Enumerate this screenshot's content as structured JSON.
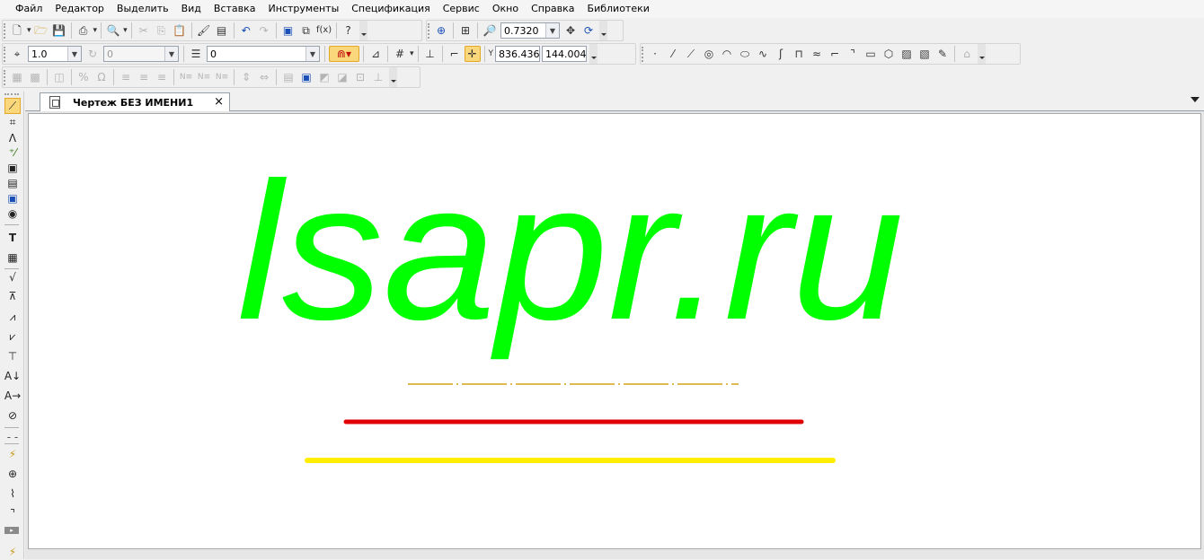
{
  "menu": [
    "Файл",
    "Редактор",
    "Выделить",
    "Вид",
    "Вставка",
    "Инструменты",
    "Спецификация",
    "Сервис",
    "Окно",
    "Справка",
    "Библиотеки"
  ],
  "toolbar": {
    "zoom_value": "0.7320",
    "step_value": "1.0",
    "angle_value": "0",
    "layer_value": "0",
    "coord_x": "836.436",
    "coord_y": "144.004",
    "fx_label": "f(x)"
  },
  "document": {
    "tab_title": "Чертеж БЕЗ ИМЕНИ1",
    "close_glyph": "×"
  },
  "drawing": {
    "logo_text": "lsapr.ru",
    "colors": {
      "logo": "#00ff00",
      "dashdot_line": "#d4a017",
      "red_line": "#e00000",
      "yellow_line": "#ffee00"
    }
  }
}
